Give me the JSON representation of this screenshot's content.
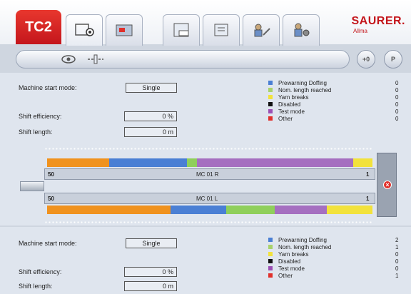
{
  "header": {
    "brand_label": "TC2",
    "logo_text": "SAURER.",
    "logo_sub": "Allma",
    "tabs": [
      {
        "icon": "machine-overview-icon",
        "active": true
      },
      {
        "icon": "production-data-icon",
        "active": false
      },
      {
        "icon": "counter-icon",
        "active": false
      },
      {
        "icon": "report-icon",
        "active": false
      },
      {
        "icon": "service-settings-icon",
        "active": false
      },
      {
        "icon": "configuration-icon",
        "active": false
      }
    ]
  },
  "toolbar": {
    "buttons": [
      {
        "icon": "eye-icon"
      },
      {
        "icon": "spindle-icon"
      }
    ],
    "round_buttons": [
      {
        "label": "+0"
      },
      {
        "label": "P"
      }
    ]
  },
  "upper_panel": {
    "start_mode_label": "Machine start mode:",
    "start_mode_value": "Single",
    "efficiency_label": "Shift efficiency:",
    "efficiency_value": "0 %",
    "length_label": "Shift length:",
    "length_value": "0 m",
    "legend": [
      {
        "label": "Prewarning Doffing",
        "color": "#4a7fd4",
        "value": "0"
      },
      {
        "label": "Nom. length reached",
        "color": "#a8d26b",
        "value": "0"
      },
      {
        "label": "Yarn breaks",
        "color": "#f2e23c",
        "value": "0"
      },
      {
        "label": "Disabled",
        "color": "#111111",
        "value": "0"
      },
      {
        "label": "Test mode",
        "color": "#9b4fb4",
        "value": "0"
      },
      {
        "label": "Other",
        "color": "#e0302b",
        "value": "0"
      }
    ]
  },
  "machine": {
    "side_r": {
      "start": "50",
      "name": "MC 01 R",
      "end": "1",
      "segments": [
        {
          "color": "#f0921e",
          "pct": 19
        },
        {
          "color": "#4a7fd4",
          "pct": 24
        },
        {
          "color": "#8fcf5b",
          "pct": 3
        },
        {
          "color": "#a56fc0",
          "pct": 48
        },
        {
          "color": "#f2e23c",
          "pct": 6
        }
      ]
    },
    "side_l": {
      "start": "50",
      "name": "MC 01 L",
      "end": "1",
      "segments": [
        {
          "color": "#f0921e",
          "pct": 38
        },
        {
          "color": "#4a7fd4",
          "pct": 17
        },
        {
          "color": "#8fcf5b",
          "pct": 15
        },
        {
          "color": "#a56fc0",
          "pct": 16
        },
        {
          "color": "#f2e23c",
          "pct": 14
        }
      ]
    }
  },
  "lower_panel": {
    "start_mode_label": "Machine start mode:",
    "start_mode_value": "Single",
    "efficiency_label": "Shift efficiency:",
    "efficiency_value": "0 %",
    "length_label": "Shift length:",
    "length_value": "0 m",
    "legend": [
      {
        "label": "Prewarning Doffing",
        "color": "#4a7fd4",
        "value": "2"
      },
      {
        "label": "Nom. length reached",
        "color": "#a8d26b",
        "value": "1"
      },
      {
        "label": "Yarn breaks",
        "color": "#f2e23c",
        "value": "0"
      },
      {
        "label": "Disabled",
        "color": "#111111",
        "value": "0"
      },
      {
        "label": "Test mode",
        "color": "#9b4fb4",
        "value": "0"
      },
      {
        "label": "Other",
        "color": "#e0302b",
        "value": "1"
      }
    ]
  }
}
